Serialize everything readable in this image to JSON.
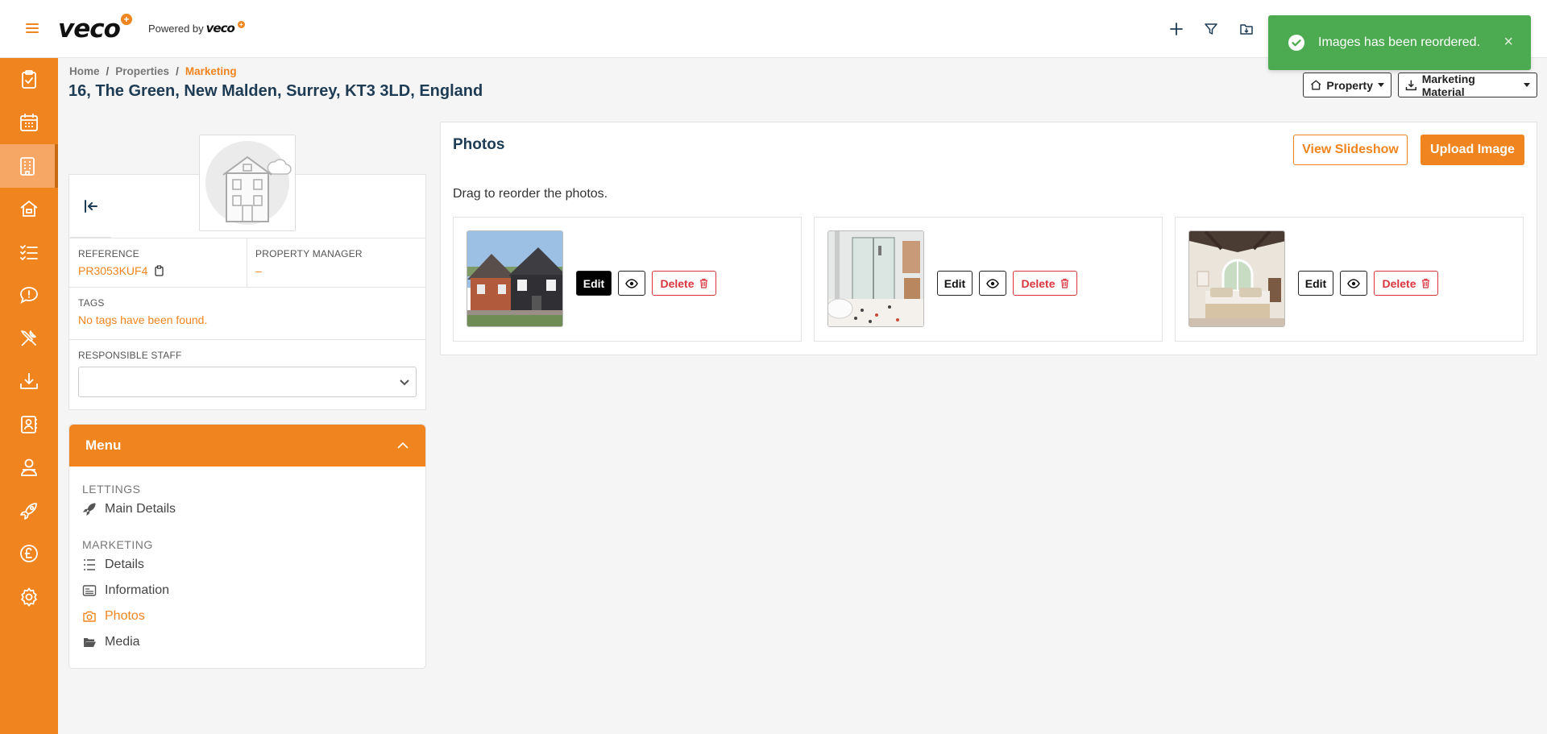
{
  "topbar": {
    "logo": "veco",
    "powered_by": "Powered by",
    "powered_logo": "veco",
    "icons": [
      "plus-icon",
      "filter-icon",
      "folder-download-icon"
    ]
  },
  "toast": {
    "message": "Images has been reordered.",
    "close": "×",
    "color": "#4caa50"
  },
  "sidebar": {
    "items": [
      "clipboard-check-icon",
      "calendar-icon",
      "building-icon",
      "home-icon",
      "task-list-icon",
      "chat-icon",
      "tools-icon",
      "download-tray-icon",
      "contacts-icon",
      "user-icon",
      "rocket-icon",
      "pound-icon",
      "settings-icon"
    ],
    "active_index": 2
  },
  "breadcrumb": [
    "Home",
    "Properties",
    "Marketing"
  ],
  "breadcrumb_sep": "/",
  "page_title": "16, The Green, New Malden, Surrey, KT3 3LD, England",
  "header_buttons": {
    "property": "Property",
    "marketing_material": "Marketing Material"
  },
  "property": {
    "reference_label": "REFERENCE",
    "reference_value": "PR3053KUF4",
    "manager_label": "PROPERTY MANAGER",
    "manager_value": "–",
    "tags_label": "TAGS",
    "tags_value": "No tags have been found.",
    "staff_label": "RESPONSIBLE STAFF",
    "staff_value": ""
  },
  "menu": {
    "title": "Menu",
    "sections": [
      {
        "title": "LETTINGS",
        "items": [
          {
            "label": "Main Details",
            "icon": "rocket-icon"
          }
        ]
      },
      {
        "title": "MARKETING",
        "items": [
          {
            "label": "Details",
            "icon": "list-icon"
          },
          {
            "label": "Information",
            "icon": "id-card-icon"
          },
          {
            "label": "Photos",
            "icon": "camera-icon"
          },
          {
            "label": "Media",
            "icon": "folder-open-icon"
          }
        ]
      }
    ],
    "current": "Photos"
  },
  "photos": {
    "title": "Photos",
    "hint": "Drag to reorder the photos.",
    "slideshow_label": "View Slideshow",
    "upload_label": "Upload Image",
    "items": [
      {
        "subject": "house exterior",
        "edit": "Edit",
        "delete": "Delete"
      },
      {
        "subject": "bathroom",
        "edit": "Edit",
        "delete": "Delete"
      },
      {
        "subject": "bedroom",
        "edit": "Edit",
        "delete": "Delete"
      }
    ]
  },
  "colors": {
    "accent": "#f0841e",
    "title": "#1e3b54",
    "danger": "#d9363e",
    "success": "#4caa50"
  }
}
